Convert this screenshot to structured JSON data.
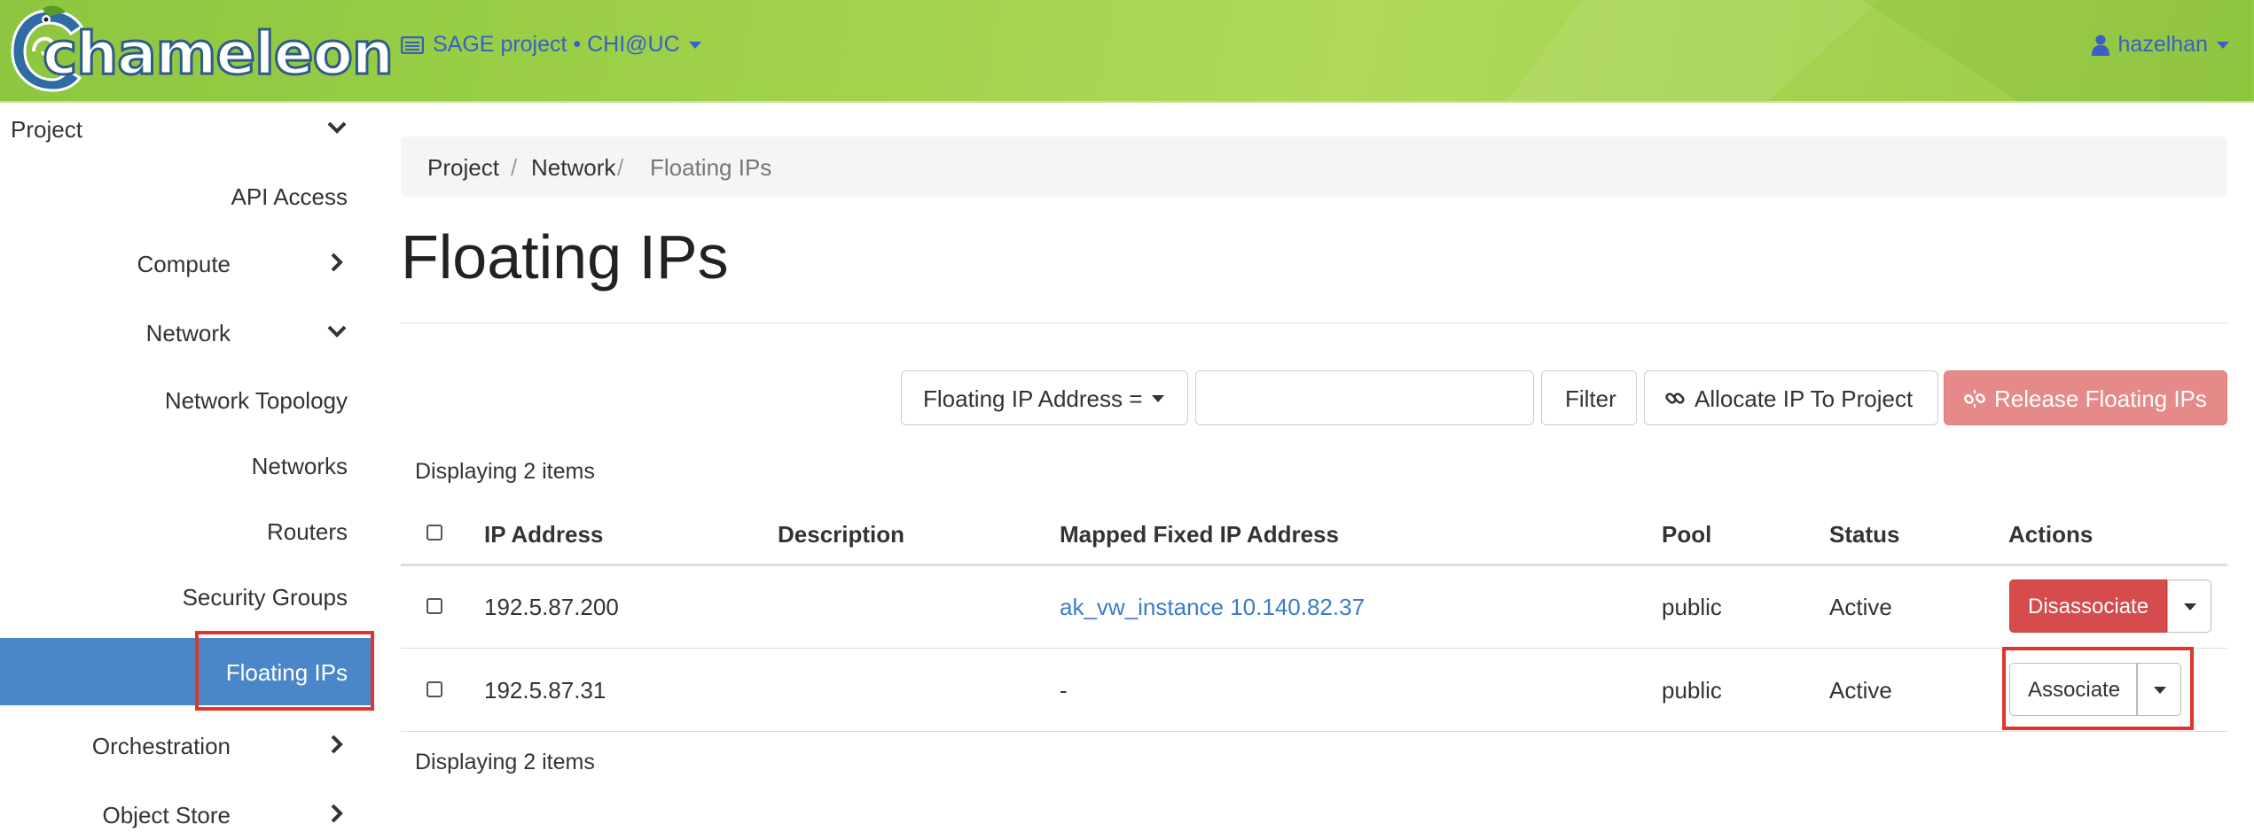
{
  "header": {
    "logo_text": "chameleon",
    "project_selector": "SAGE project • CHI@UC",
    "user": "hazelhan"
  },
  "sidebar": {
    "items": [
      {
        "label": "Project"
      },
      {
        "label": "API Access"
      },
      {
        "label": "Compute"
      },
      {
        "label": "Network"
      },
      {
        "label": "Network Topology"
      },
      {
        "label": "Networks"
      },
      {
        "label": "Routers"
      },
      {
        "label": "Security Groups"
      },
      {
        "label": "Floating IPs"
      },
      {
        "label": "Orchestration"
      },
      {
        "label": "Object Store"
      }
    ]
  },
  "breadcrumb": {
    "items": [
      "Project",
      "Network",
      "Floating IPs"
    ],
    "separator": "/"
  },
  "page": {
    "title": "Floating IPs"
  },
  "toolbar": {
    "filter_field": "Floating IP Address =",
    "filter_value": "",
    "filter_button": "Filter",
    "allocate_button": "Allocate IP To Project",
    "release_button": "Release Floating IPs"
  },
  "table": {
    "count_text": "Displaying 2 items",
    "columns": [
      "IP Address",
      "Description",
      "Mapped Fixed IP Address",
      "Pool",
      "Status",
      "Actions"
    ],
    "rows": [
      {
        "ip": "192.5.87.200",
        "description": "",
        "mapped": "ak_vw_instance 10.140.82.37",
        "pool": "public",
        "status": "Active",
        "action": "Disassociate"
      },
      {
        "ip": "192.5.87.31",
        "description": "",
        "mapped": "-",
        "pool": "public",
        "status": "Active",
        "action": "Associate"
      }
    ]
  },
  "colors": {
    "header_green": "#98cc44",
    "link_blue": "#3a7cc8",
    "active_nav": "#4a86c8",
    "danger": "#d64b4b",
    "highlight_box": "#e0352b"
  }
}
